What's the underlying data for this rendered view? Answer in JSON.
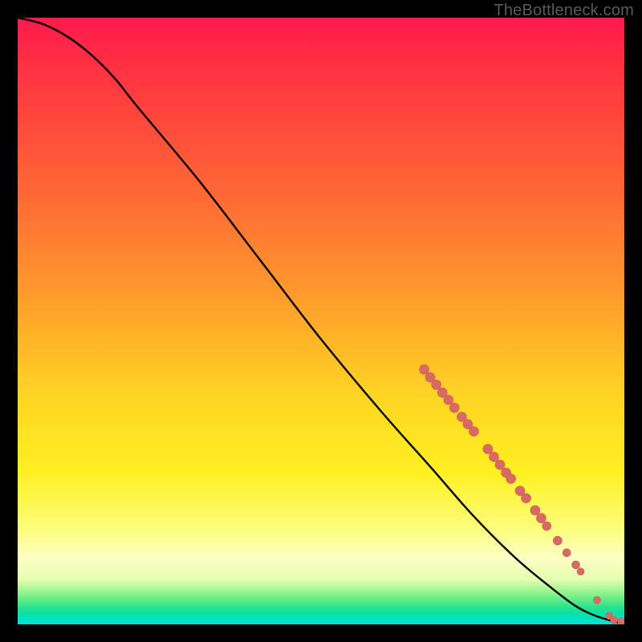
{
  "watermark": "TheBottleneck.com",
  "colors": {
    "curve_stroke": "#000000",
    "dot_fill": "#d86a63",
    "dot_stroke": "#c95c56"
  },
  "chart_data": {
    "type": "line",
    "title": "",
    "xlabel": "",
    "ylabel": "",
    "xlim": [
      0,
      100
    ],
    "ylim": [
      0,
      100
    ],
    "grid": false,
    "legend": false,
    "series": [
      {
        "name": "curve",
        "kind": "line",
        "x": [
          0,
          4,
          8,
          12,
          16,
          20,
          30,
          40,
          50,
          60,
          68,
          75,
          82,
          88,
          92,
          95,
          97.5,
          99,
          100
        ],
        "y": [
          100,
          99,
          97,
          94,
          90,
          85,
          73,
          60,
          47,
          35,
          26,
          18,
          11,
          6,
          3,
          1.5,
          0.7,
          0.3,
          0.25
        ]
      },
      {
        "name": "dots",
        "kind": "scatter",
        "points": [
          {
            "x": 67.0,
            "y": 42.0,
            "r": 6
          },
          {
            "x": 68.0,
            "y": 40.7,
            "r": 6
          },
          {
            "x": 69.0,
            "y": 39.5,
            "r": 6
          },
          {
            "x": 70.0,
            "y": 38.2,
            "r": 6
          },
          {
            "x": 71.0,
            "y": 37.0,
            "r": 6
          },
          {
            "x": 72.0,
            "y": 35.7,
            "r": 6
          },
          {
            "x": 73.2,
            "y": 34.2,
            "r": 6
          },
          {
            "x": 74.2,
            "y": 33.0,
            "r": 6
          },
          {
            "x": 75.2,
            "y": 31.8,
            "r": 6
          },
          {
            "x": 77.5,
            "y": 28.9,
            "r": 6
          },
          {
            "x": 78.5,
            "y": 27.6,
            "r": 6
          },
          {
            "x": 79.5,
            "y": 26.3,
            "r": 6
          },
          {
            "x": 80.5,
            "y": 25.0,
            "r": 6
          },
          {
            "x": 81.3,
            "y": 24.0,
            "r": 6
          },
          {
            "x": 82.8,
            "y": 22.0,
            "r": 6
          },
          {
            "x": 83.8,
            "y": 20.8,
            "r": 6
          },
          {
            "x": 85.3,
            "y": 18.8,
            "r": 6
          },
          {
            "x": 86.3,
            "y": 17.5,
            "r": 6
          },
          {
            "x": 87.2,
            "y": 16.2,
            "r": 5.5
          },
          {
            "x": 89.0,
            "y": 13.8,
            "r": 5.5
          },
          {
            "x": 90.5,
            "y": 11.8,
            "r": 5
          },
          {
            "x": 92.0,
            "y": 9.8,
            "r": 5
          },
          {
            "x": 92.8,
            "y": 8.7,
            "r": 4.5
          },
          {
            "x": 95.5,
            "y": 4.0,
            "r": 4.5
          },
          {
            "x": 97.5,
            "y": 1.4,
            "r": 4.5
          },
          {
            "x": 98.3,
            "y": 0.7,
            "r": 4.5
          },
          {
            "x": 99.5,
            "y": 0.5,
            "r": 4.5
          }
        ]
      }
    ]
  }
}
